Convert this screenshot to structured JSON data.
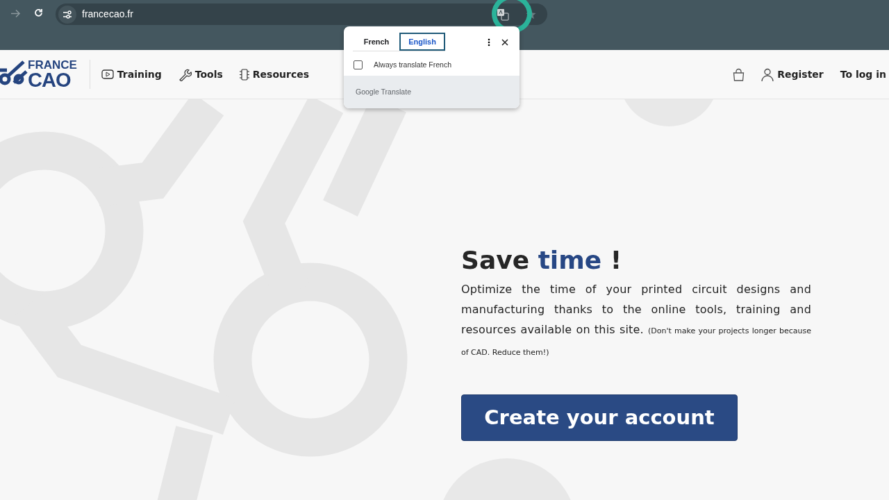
{
  "browser": {
    "url": "francecao.fr"
  },
  "translate_popup": {
    "tabs": [
      {
        "label": "French",
        "selected": false
      },
      {
        "label": "English",
        "selected": true
      }
    ],
    "always_translate": {
      "label": "Always translate French",
      "checked": false
    },
    "footer": "Google Translate"
  },
  "site_header": {
    "logo": [
      "FRANCE",
      "CAO"
    ],
    "nav": [
      {
        "label": "Training",
        "kind": "video"
      },
      {
        "label": "Tools",
        "kind": "tool"
      },
      {
        "label": "Resources",
        "kind": "resource"
      }
    ],
    "register": "Register",
    "login": "To log in"
  },
  "hero": {
    "title": [
      {
        "text": "Save ",
        "accent": false
      },
      {
        "text": "time",
        "accent": true
      },
      {
        "text": " !",
        "accent": false
      }
    ],
    "description": "Optimize the time of your printed circuit designs and manufacturing thanks to the online tools, training and resources available on this site.",
    "note": "(Don't make your projects longer because of CAD. Reduce them!)",
    "button": "Create your account"
  }
}
